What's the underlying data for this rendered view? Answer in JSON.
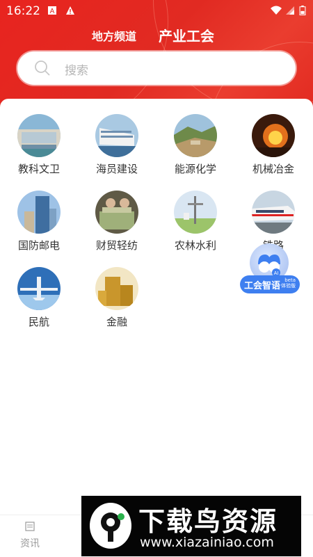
{
  "status_bar": {
    "time": "16:22"
  },
  "header": {
    "tabs": [
      {
        "label": "地方频道"
      },
      {
        "label": "产业工会"
      }
    ]
  },
  "search": {
    "placeholder": "搜索"
  },
  "categories": [
    {
      "label": "教科文卫",
      "icon": "school-building-photo"
    },
    {
      "label": "海员建设",
      "icon": "cruise-ship-photo"
    },
    {
      "label": "能源化学",
      "icon": "mining-landscape-photo"
    },
    {
      "label": "机械冶金",
      "icon": "molten-metal-photo"
    },
    {
      "label": "国防邮电",
      "icon": "city-tower-photo"
    },
    {
      "label": "财贸轻纺",
      "icon": "money-stacks-photo"
    },
    {
      "label": "农林水利",
      "icon": "weather-station-photo"
    },
    {
      "label": "铁路",
      "icon": "high-speed-train-photo"
    },
    {
      "label": "民航",
      "icon": "airplane-photo"
    },
    {
      "label": "金融",
      "icon": "gold-coins-photo"
    }
  ],
  "ai_assistant": {
    "label": "工会智语",
    "badge": "beta\n体验版"
  },
  "bottom_nav": {
    "news": {
      "label": "资讯"
    }
  },
  "watermark": {
    "title": "下载鸟资源",
    "url": "www.xiazainiao.com"
  },
  "colors": {
    "brand_red": "#e3261f",
    "ai_blue": "#3e7ff0"
  }
}
